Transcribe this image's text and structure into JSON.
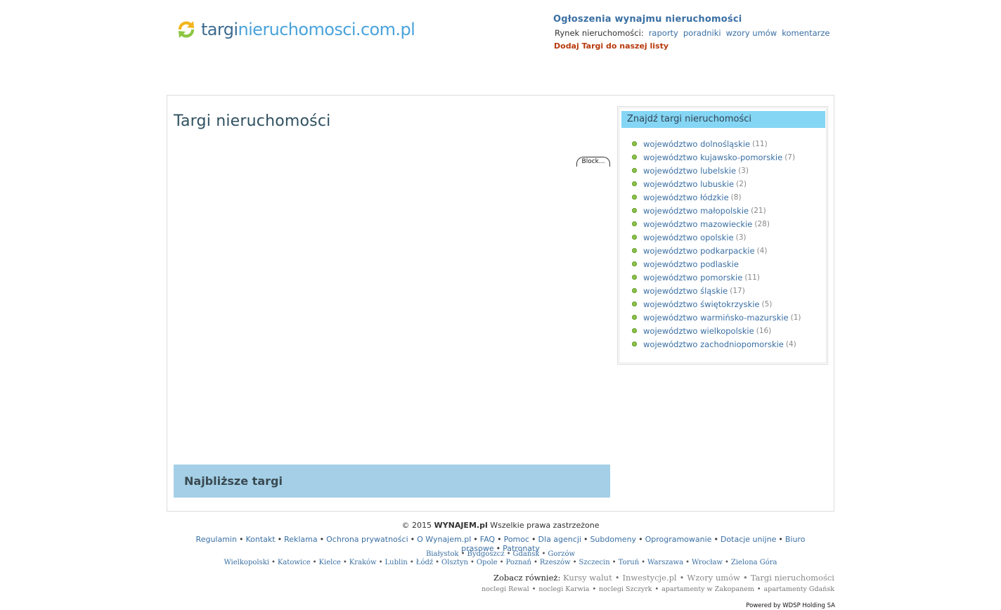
{
  "header": {
    "logo": {
      "part1": "targi",
      "part2": "nieruchomosci",
      "part3": ".com.pl"
    },
    "title": "Ogłoszenia wynajmu nieruchomości",
    "market_label": "Rynek nieruchomości:",
    "market_links": [
      "raporty",
      "poradniki",
      "wzory umów",
      "komentarze"
    ],
    "add_link": "Dodaj Targi do naszej listy"
  },
  "main": {
    "page_title": "Targi nieruchomości",
    "block_badge": "Block...",
    "nearest_title": "Najbliższe targi"
  },
  "sidebar": {
    "title": "Znajdź targi nieruchomości",
    "items": [
      {
        "label": "województwo dolnośląskie",
        "count": "(11)"
      },
      {
        "label": "województwo kujawsko-pomorskie",
        "count": "(7)"
      },
      {
        "label": "województwo lubelskie",
        "count": "(3)"
      },
      {
        "label": "województwo lubuskie",
        "count": "(2)"
      },
      {
        "label": "województwo łódzkie",
        "count": "(8)"
      },
      {
        "label": "województwo małopolskie",
        "count": "(21)"
      },
      {
        "label": "województwo mazowieckie",
        "count": "(28)"
      },
      {
        "label": "województwo opolskie",
        "count": "(3)"
      },
      {
        "label": "województwo podkarpackie",
        "count": "(4)"
      },
      {
        "label": "województwo podlaskie",
        "count": ""
      },
      {
        "label": "województwo pomorskie",
        "count": "(11)"
      },
      {
        "label": "województwo śląskie",
        "count": "(17)"
      },
      {
        "label": "województwo świętokrzyskie",
        "count": "(5)"
      },
      {
        "label": "województwo warmińsko-mazurskie",
        "count": "(1)"
      },
      {
        "label": "województwo wielkopolskie",
        "count": "(16)"
      },
      {
        "label": "województwo zachodniopomorskie",
        "count": "(4)"
      }
    ]
  },
  "footer": {
    "copy_prefix": "© 2015",
    "copy_brand": "WYNAJEM.pl",
    "copy_suffix": "Wszelkie prawa zastrzeżone",
    "links": [
      "Regulamin",
      "Kontakt",
      "Reklama",
      "Ochrona prywatności",
      "O Wynajem.pl",
      "FAQ",
      "Pomoc",
      "Dla agencji",
      "Subdomeny",
      "Oprogramowanie",
      "Dotacje unijne",
      "Biuro prasowe",
      "Patronaty"
    ],
    "cities": [
      "Białystok",
      "Bydgoszcz",
      "Gdańsk",
      "Gorzów Wielkopolski",
      "Katowice",
      "Kielce",
      "Kraków",
      "Lublin",
      "Łódź",
      "Olsztyn",
      "Opole",
      "Poznań",
      "Rzeszów",
      "Szczecin",
      "Toruń",
      "Warszawa",
      "Wrocław",
      "Zielona Góra"
    ],
    "see_label": "Zobacz również:",
    "see_links": [
      "Kursy walut",
      "Inwestycje.pl",
      "Wzory umów",
      "Targi nieruchomości"
    ],
    "noclegi": [
      "noclegi Rewal",
      "noclegi Karwia",
      "noclegi Szczyrk",
      "apartamenty w Zakopanem",
      "apartamenty Gdańsk"
    ],
    "powered": "Powered by WDSP Holding SA"
  }
}
